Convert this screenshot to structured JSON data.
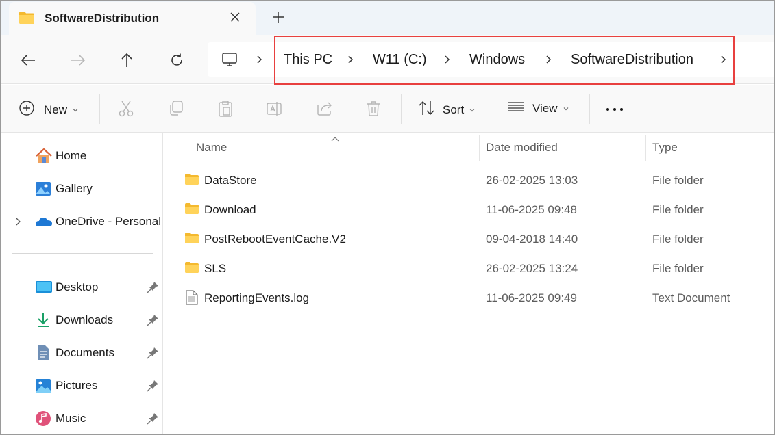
{
  "window": {
    "tab_title": "SoftwareDistribution",
    "new_tab_glyph": "+"
  },
  "address": {
    "breadcrumbs": [
      "This PC",
      "W11 (C:)",
      "Windows",
      "SoftwareDistribution"
    ]
  },
  "commands": {
    "new_label": "New",
    "sort_label": "Sort",
    "view_label": "View"
  },
  "sidebar": {
    "top": [
      {
        "label": "Home",
        "icon": "home-icon"
      },
      {
        "label": "Gallery",
        "icon": "gallery-icon"
      },
      {
        "label": "OneDrive - Personal",
        "icon": "onedrive-cloud-icon"
      }
    ],
    "quick_access": [
      {
        "label": "Desktop",
        "icon": "desktop-icon"
      },
      {
        "label": "Downloads",
        "icon": "download-arrow-icon"
      },
      {
        "label": "Documents",
        "icon": "documents-icon"
      },
      {
        "label": "Pictures",
        "icon": "pictures-icon"
      },
      {
        "label": "Music",
        "icon": "music-icon"
      }
    ]
  },
  "columns": {
    "name": "Name",
    "date": "Date modified",
    "type": "Type"
  },
  "files": [
    {
      "name": "DataStore",
      "date": "26-02-2025 13:03",
      "type": "File folder",
      "icon": "folder-icon"
    },
    {
      "name": "Download",
      "date": "11-06-2025 09:48",
      "type": "File folder",
      "icon": "folder-icon"
    },
    {
      "name": "PostRebootEventCache.V2",
      "date": "09-04-2018 14:40",
      "type": "File folder",
      "icon": "folder-icon"
    },
    {
      "name": "SLS",
      "date": "26-02-2025 13:24",
      "type": "File folder",
      "icon": "folder-icon"
    },
    {
      "name": "ReportingEvents.log",
      "date": "11-06-2025 09:49",
      "type": "Text Document",
      "icon": "text-file-icon"
    }
  ],
  "colors": {
    "highlight": "#e8403f",
    "folder": "#f8c93f",
    "accent": "#0067c0"
  }
}
